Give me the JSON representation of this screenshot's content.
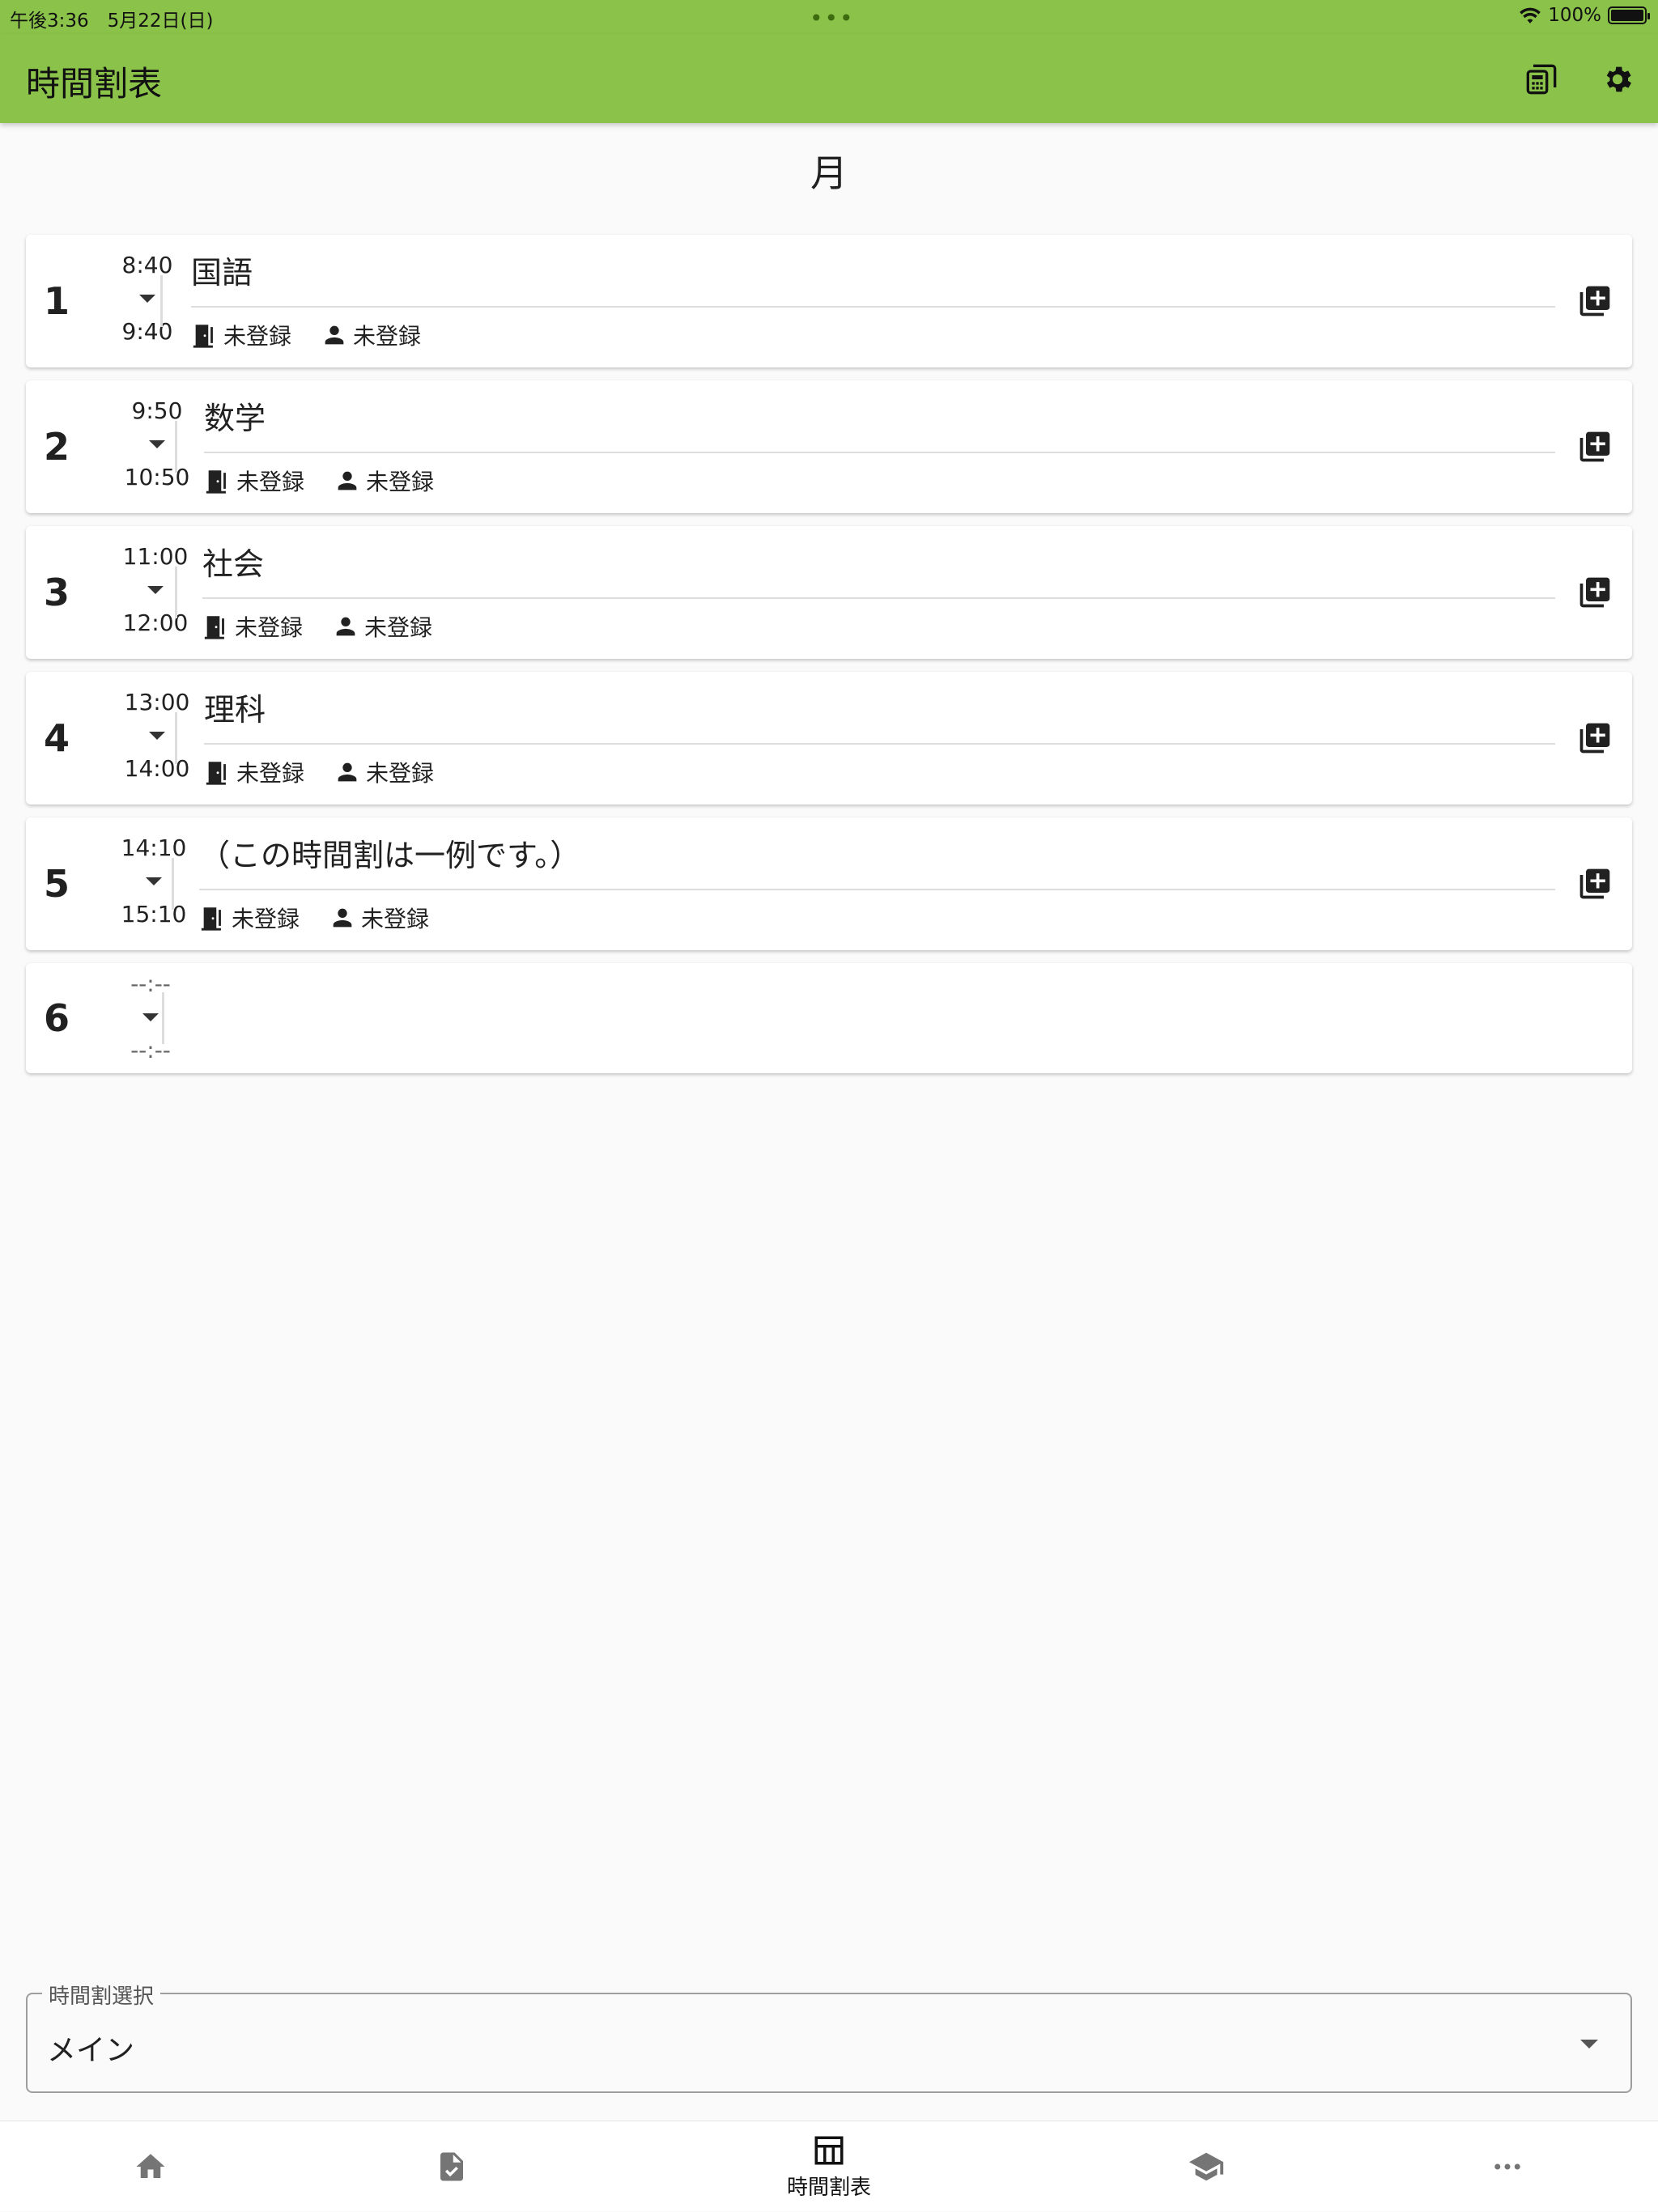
{
  "status": {
    "time": "午後3:36　5月22日(日)",
    "battery": "100%"
  },
  "app": {
    "title": "時間割表"
  },
  "day": "月",
  "periods": [
    {
      "num": "1",
      "start": "8:40",
      "end": "9:40",
      "subject": "国語",
      "room": "未登録",
      "teacher": "未登録"
    },
    {
      "num": "2",
      "start": "9:50",
      "end": "10:50",
      "subject": "数学",
      "room": "未登録",
      "teacher": "未登録"
    },
    {
      "num": "3",
      "start": "11:00",
      "end": "12:00",
      "subject": "社会",
      "room": "未登録",
      "teacher": "未登録"
    },
    {
      "num": "4",
      "start": "13:00",
      "end": "14:00",
      "subject": "理科",
      "room": "未登録",
      "teacher": "未登録"
    },
    {
      "num": "5",
      "start": "14:10",
      "end": "15:10",
      "subject": "（この時間割は一例です。）",
      "room": "未登録",
      "teacher": "未登録"
    },
    {
      "num": "6",
      "start": "--:--",
      "end": "--:--"
    }
  ],
  "selector": {
    "label": "時間割選択",
    "value": "メイン"
  },
  "nav": {
    "timetable_label": "時間割表"
  },
  "colors": {
    "accent": "#8bc34a"
  }
}
